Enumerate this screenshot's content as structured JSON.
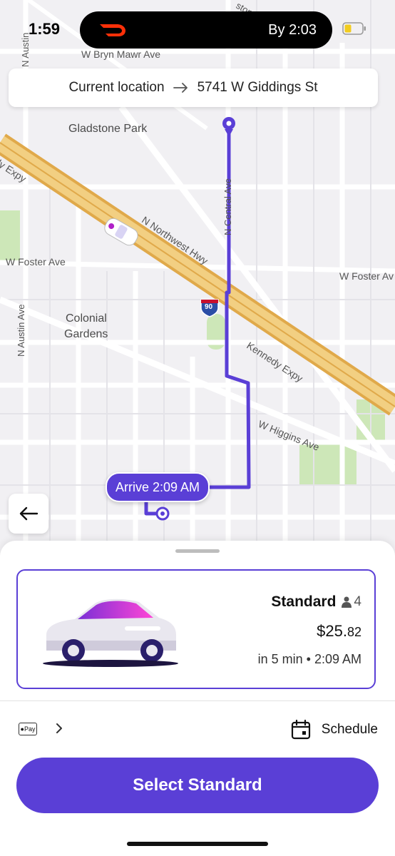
{
  "status_bar": {
    "time": "1:59"
  },
  "live_activity": {
    "eta_text": "By 2:03"
  },
  "route": {
    "origin": "Current location",
    "destination": "5741 W Giddings St"
  },
  "map": {
    "labels": {
      "bryn_mawr": "W Bryn Mawr Ave",
      "gladstone_park": "Gladstone Park",
      "kennedy_expy_top": "dy Expy",
      "northwest_hwy": "N Northwest Hwy",
      "central_ave": "N Central Ave",
      "foster_left": "W Foster Ave",
      "foster_right": "W Foster Av",
      "colonial": "Colonial",
      "gardens": "Gardens",
      "austin_top": "N Austin",
      "austin_bottom": "N Austin Ave",
      "kennedy_expy": "Kennedy Expy",
      "higgins": "W Higgins Ave",
      "interstate": "90",
      "top_street": "ston A"
    },
    "arrive_label": "Arrive 2:09 AM"
  },
  "ride_option": {
    "name": "Standard",
    "seats": "4",
    "price_dollars": "$25.",
    "price_cents": "82",
    "eta": "in 5 min • 2:09 AM"
  },
  "payment": {
    "method_label": "Pay"
  },
  "schedule_label": "Schedule",
  "select_button_label": "Select Standard",
  "colors": {
    "accent": "#5a3fd6",
    "highway": "#e8c06a",
    "park": "#cde7b8"
  }
}
